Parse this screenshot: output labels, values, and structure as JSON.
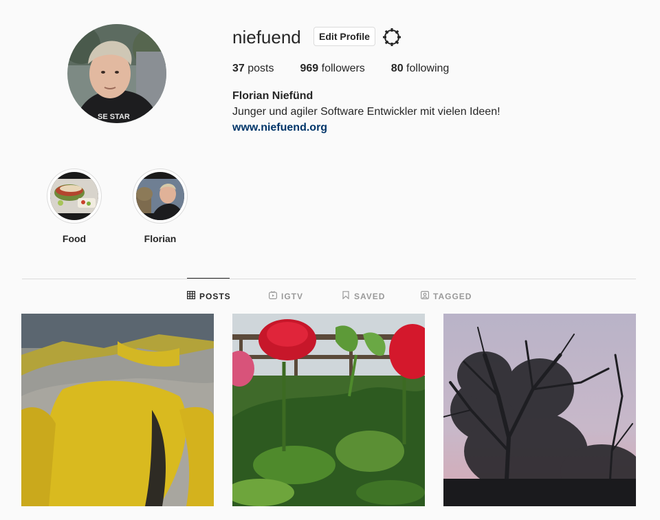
{
  "profile": {
    "username": "niefuend",
    "edit_label": "Edit Profile",
    "stats": {
      "posts_count": "37",
      "posts_label": "posts",
      "followers_count": "969",
      "followers_label": "followers",
      "following_count": "80",
      "following_label": "following"
    },
    "full_name": "Florian Niefünd",
    "bio": "Junger und agiler Software Entwickler mit vielen Ideen!",
    "website": "www.niefuend.org",
    "avatar_text": "SE STAR"
  },
  "highlights": [
    {
      "label": "Food"
    },
    {
      "label": "Florian"
    }
  ],
  "tabs": [
    {
      "label": "POSTS",
      "icon": "grid-icon",
      "active": true
    },
    {
      "label": "IGTV",
      "icon": "igtv-icon",
      "active": false
    },
    {
      "label": "SAVED",
      "icon": "bookmark-icon",
      "active": false
    },
    {
      "label": "TAGGED",
      "icon": "tagged-icon",
      "active": false
    }
  ],
  "posts": [
    {
      "subject": "yellow lichen on rocks"
    },
    {
      "subject": "red flowers in garden"
    },
    {
      "subject": "bare trees at dusk"
    }
  ],
  "colors": {
    "link": "#003569",
    "border": "#dbdbdb",
    "text": "#262626",
    "muted": "#999999",
    "background": "#fafafa"
  }
}
